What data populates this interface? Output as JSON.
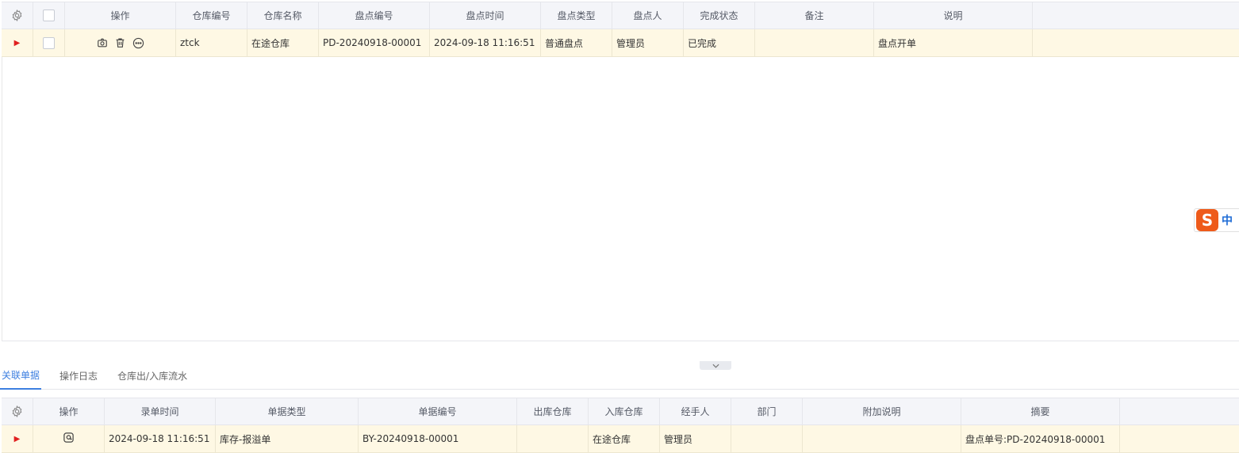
{
  "main_table": {
    "headers": [
      "操作",
      "仓库编号",
      "仓库名称",
      "盘点编号",
      "盘点时间",
      "盘点类型",
      "盘点人",
      "完成状态",
      "备注",
      "说明"
    ],
    "rows": [
      {
        "warehouse_code": "ztck",
        "warehouse_name": "在途仓库",
        "inventory_no": "PD-20240918-00001",
        "inventory_time": "2024-09-18 11:16:51",
        "inventory_type": "普通盘点",
        "counter": "管理员",
        "status": "已完成",
        "remark": "",
        "description": "盘点开单"
      }
    ],
    "row_icons": [
      "camera-icon",
      "trash-icon",
      "more-icon"
    ]
  },
  "tabs": [
    {
      "label": "关联单据",
      "active": true
    },
    {
      "label": "操作日志",
      "active": false
    },
    {
      "label": "仓库出/入库流水",
      "active": false
    }
  ],
  "related_table": {
    "headers": [
      "操作",
      "录单时间",
      "单据类型",
      "单据编号",
      "出库仓库",
      "入库仓库",
      "经手人",
      "部门",
      "附加说明",
      "摘要"
    ],
    "rows": [
      {
        "entry_time": "2024-09-18 11:16:51",
        "doc_type": "库存-报溢单",
        "doc_no": "BY-20240918-00001",
        "out_warehouse": "",
        "in_warehouse": "在途仓库",
        "handler": "管理员",
        "department": "",
        "extra": "",
        "summary": "盘点单号:PD-20240918-00001"
      }
    ]
  },
  "ime": {
    "label": "中",
    "logo": "S"
  },
  "colors": {
    "header_bg": "#f4f5f9",
    "selected_row_bg": "#fef8e4",
    "row_arrow": "#e02020",
    "tab_active": "#3d7fe0",
    "ime_logo": "#ee5a1a"
  }
}
